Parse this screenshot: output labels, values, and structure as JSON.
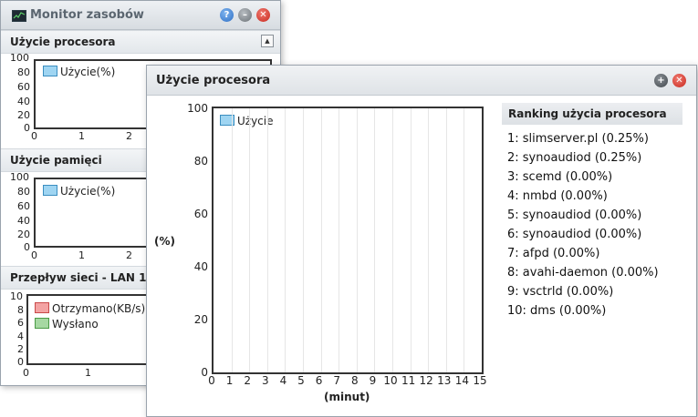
{
  "back_window": {
    "title": "Monitor zasobów",
    "buttons": {
      "help": "?",
      "minimize": "–",
      "close": "✕"
    },
    "cpu_section": {
      "title": "Użycie procesora",
      "legend": [
        "Użycie(%)"
      ],
      "y_ticks": [
        "100",
        "80",
        "60",
        "40",
        "20",
        "0"
      ],
      "x_ticks": [
        "0",
        "1",
        "2"
      ]
    },
    "mem_section": {
      "title": "Użycie pamięci",
      "legend": [
        "Użycie(%)"
      ],
      "y_ticks": [
        "100",
        "80",
        "60",
        "40",
        "20",
        "0"
      ],
      "x_ticks": [
        "0",
        "1",
        "2"
      ]
    },
    "net_section": {
      "title": "Przepływ sieci - LAN 1",
      "legend": [
        "Otrzymano(KB/s)",
        "Wysłano"
      ],
      "y_ticks": [
        "10",
        "8",
        "6",
        "4",
        "2",
        "0"
      ],
      "x_ticks": [
        "0",
        "1",
        "2"
      ]
    }
  },
  "front_window": {
    "title": "Użycie procesora",
    "buttons": {
      "zoom": "+",
      "close": "✕"
    },
    "chart_data": {
      "type": "line",
      "legend": [
        "Użycie"
      ],
      "ylabel": "(%)",
      "xlabel": "(minut)",
      "y_ticks": [
        "100",
        "80",
        "60",
        "40",
        "20",
        "0"
      ],
      "x_ticks": [
        "0",
        "1",
        "2",
        "3",
        "4",
        "5",
        "6",
        "7",
        "8",
        "9",
        "10",
        "11",
        "12",
        "13",
        "14",
        "15"
      ],
      "ylim": [
        0,
        100
      ],
      "xlim": [
        0,
        15
      ],
      "series": [
        {
          "name": "Użycie",
          "values": []
        }
      ],
      "grid": true,
      "colors": {
        "series": "#9fd5f2"
      }
    },
    "ranking": {
      "title": "Ranking użycia procesora",
      "items": [
        "1: slimserver.pl (0.25%)",
        "2: synoaudiod (0.25%)",
        "3: scemd (0.00%)",
        "4: nmbd (0.00%)",
        "5: synoaudiod (0.00%)",
        "6: synoaudiod (0.00%)",
        "7: afpd (0.00%)",
        "8: avahi-daemon (0.00%)",
        "9: vsctrld (0.00%)",
        "10: dms (0.00%)"
      ]
    }
  }
}
